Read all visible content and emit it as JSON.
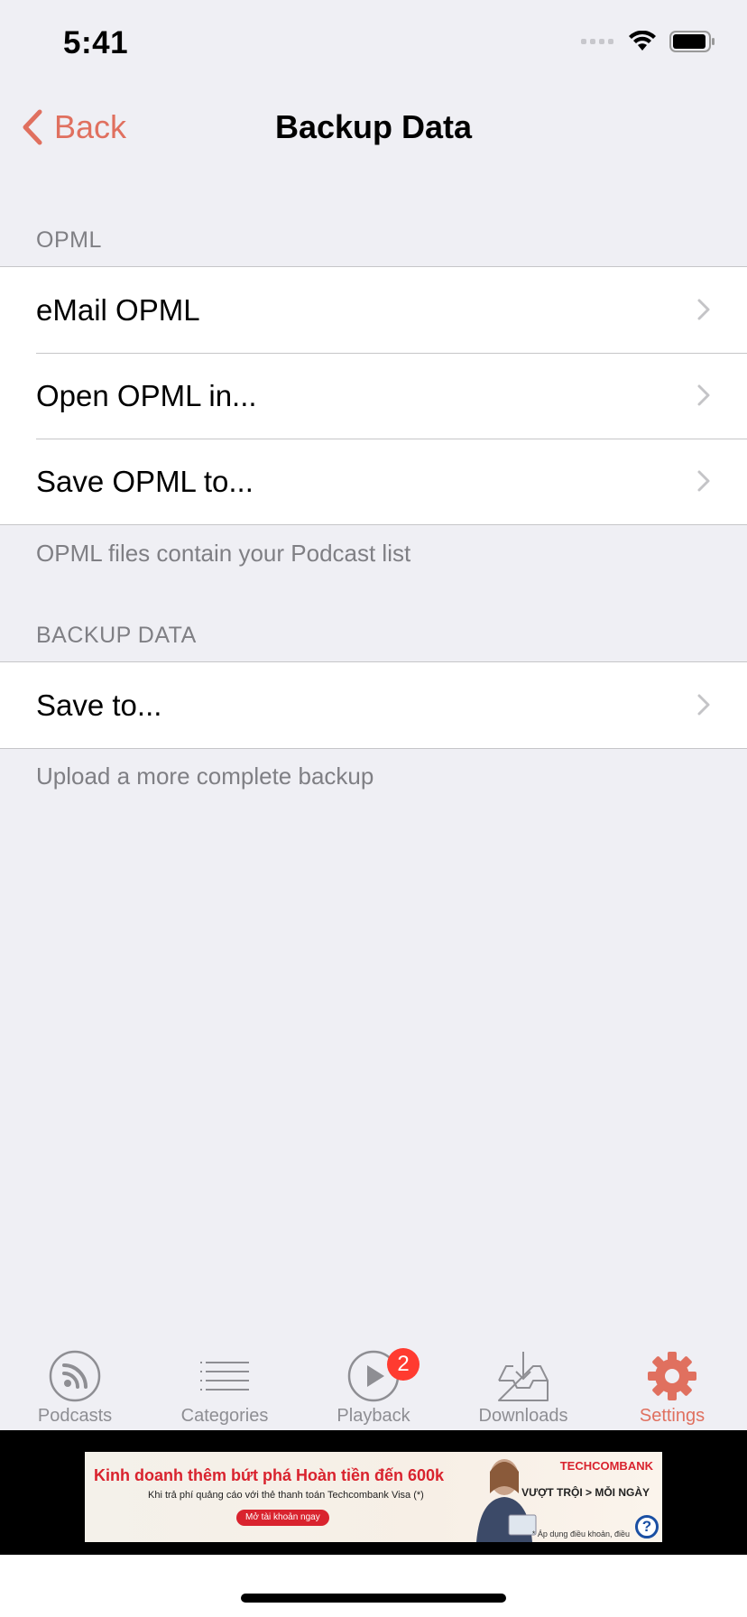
{
  "status_bar": {
    "time": "5:41"
  },
  "nav": {
    "back_label": "Back",
    "title": "Backup Data"
  },
  "sections": {
    "opml": {
      "header": "OPML",
      "rows": [
        "eMail OPML",
        "Open OPML in...",
        "Save OPML to..."
      ],
      "footer": "OPML files contain your Podcast list"
    },
    "backup": {
      "header": "BACKUP DATA",
      "rows": [
        "Save to..."
      ],
      "footer": "Upload a more complete backup"
    }
  },
  "tabs": [
    {
      "label": "Podcasts",
      "icon": "podcast-icon"
    },
    {
      "label": "Categories",
      "icon": "list-icon"
    },
    {
      "label": "Playback",
      "icon": "play-icon",
      "badge": "2"
    },
    {
      "label": "Downloads",
      "icon": "inbox-download-icon"
    },
    {
      "label": "Settings",
      "icon": "gear-icon",
      "active": true
    }
  ],
  "ad": {
    "headline": "Kinh doanh thêm bứt phá Hoàn tiền đến 600k",
    "sub": "Khi trả phí quảng cáo với thẻ thanh toán Techcombank Visa (*)",
    "cta": "Mở tài khoản ngay",
    "brand": "TECHCOMBANK",
    "slogan": "VƯỢT TRỘI > MỖI NGÀY",
    "fine_print": "* Áp dụng điều khoản, điều",
    "help": "?"
  },
  "colors": {
    "accent": "#e0705f",
    "background": "#efeff4",
    "badge": "#ff3b30"
  }
}
